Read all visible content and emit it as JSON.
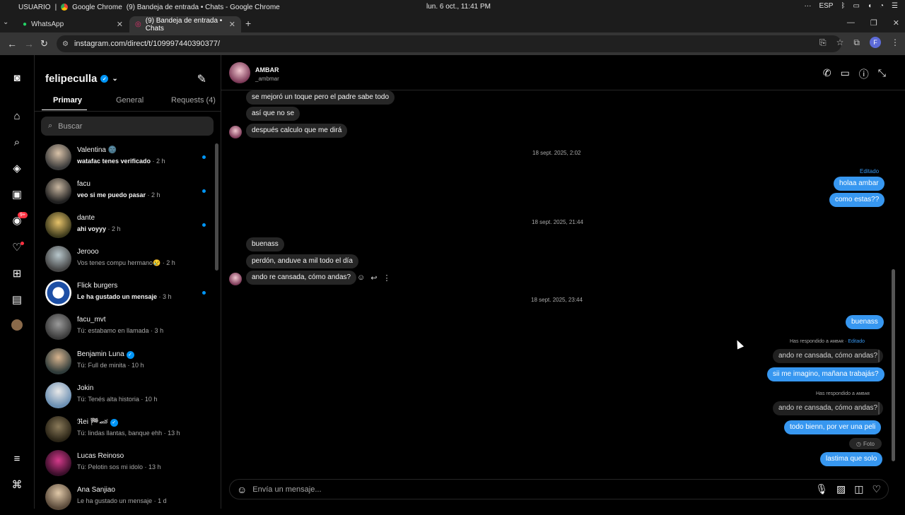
{
  "os": {
    "user": "USUARIO",
    "separator": "|",
    "app": "Google Chrome",
    "window_title": "(9) Bandeja de entrada • Chats - Google Chrome",
    "datetime": "lun. 6 oct., 11:41 PM",
    "lang": "ESP"
  },
  "tabs": [
    {
      "label": "WhatsApp",
      "icon": "whatsapp-icon"
    },
    {
      "label": "(9) Bandeja de entrada • Chats",
      "icon": "instagram-icon"
    }
  ],
  "address": {
    "url": "instagram.com/direct/t/109997440390377/",
    "profile_initial": "F"
  },
  "colors": {
    "accent": "#0095f6",
    "bubble_out": "#3797f0",
    "bubble_in": "#262626",
    "badge": "#ff3040"
  },
  "rail": {
    "notifications_badge": "9+"
  },
  "inbox": {
    "username": "felipeculla",
    "tabs": {
      "primary": "Primary",
      "general": "General",
      "requests": "Requests (4)"
    },
    "search_placeholder": "Buscar",
    "conversations": [
      {
        "name": "Valentina 🌚",
        "preview": "watafac tenes verificado",
        "time": " · 2 h",
        "unread": true
      },
      {
        "name": "facu",
        "preview": "veo si me puedo pasar",
        "time": " · 2 h",
        "unread": true
      },
      {
        "name": "dante",
        "preview": "ahi voyyy",
        "time": " · 2 h",
        "unread": true
      },
      {
        "name": "Jerooo",
        "preview": "Vos tenes compu hermano😢",
        "time": " · 2 h",
        "unread": false
      },
      {
        "name": "Flick burgers",
        "preview": "Le ha gustado un mensaje",
        "time": " · 3 h",
        "unread": true
      },
      {
        "name": "facu_mvt",
        "preview": "Tú: estabamo en llamada",
        "time": " · 3 h",
        "unread": false
      },
      {
        "name": "Benjamin Luna",
        "preview": "Tú: Full de minita",
        "time": " · 10 h",
        "unread": false
      },
      {
        "name": "Jokin",
        "preview": "Tú: Tenés alta historia",
        "time": " · 10 h",
        "unread": false
      },
      {
        "name": "ℜei 🏁🏎",
        "preview": "Tú: lindas llantas, banque ehh",
        "time": " · 13 h",
        "unread": false
      },
      {
        "name": "Lucas Reinoso",
        "preview": "Tú: Pelotin sos mi idolo",
        "time": " · 13 h",
        "unread": false
      },
      {
        "name": "Ana Sanjiao",
        "preview": "Le ha gustado un mensaje",
        "time": " · 1 d",
        "unread": false
      }
    ]
  },
  "chat": {
    "name": "AMBAR",
    "handle": "_ambmar",
    "messages": {
      "m1": "se mejoró un toque pero el padre sabe todo",
      "m2": "así que no se",
      "m3": "después calculo que me dirá",
      "ts1": "18 sept. 2025, 2:02",
      "edited1": "Editado",
      "m4": "holaa ambar",
      "m5": "como estas??",
      "ts2": "18 sept. 2025, 21:44",
      "m6": "buenass",
      "m7": "perdón, anduve a mil todo el día",
      "m8": "ando re cansada, cómo andas?",
      "ts3": "18 sept. 2025, 23:44",
      "m9": "buenass",
      "reply1_meta": "Has respondido a ᴀᴍʙᴀʀ · ",
      "reply1_edited": "Editado",
      "q1": "ando re cansada, cómo andas?",
      "m10": "sii me imagino, mañana trabajás?",
      "reply2_meta": "Has respondido a ᴀᴍʙᴀʀ",
      "q2": "ando re cansada, cómo andas?",
      "m11": "todo bienn, por ver una peli",
      "photo": "Foto",
      "m12": "lastima que solo"
    },
    "composer_placeholder": "Envía un mensaje..."
  }
}
